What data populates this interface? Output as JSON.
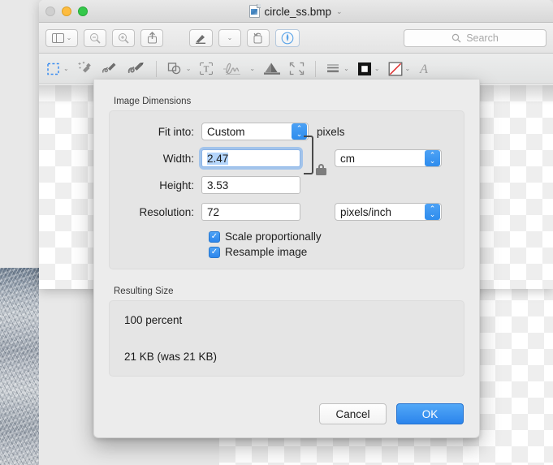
{
  "window": {
    "title": "circle_ss.bmp",
    "title_chevron": "⌄",
    "traffic_lights": [
      "close",
      "minimize",
      "zoom"
    ]
  },
  "toolbar": {
    "sidebar_label": "sidebar-view",
    "zoom_out_label": "zoom-out",
    "zoom_in_label": "zoom-in",
    "share_label": "share",
    "markup_label": "markup",
    "rotate_label": "rotate",
    "annotate_label": "annotate",
    "search_placeholder": "Search"
  },
  "markupbar": {
    "items": [
      "selection-tool",
      "instant-alpha-tool",
      "sketch-tool",
      "draw-tool",
      "shapes-tool",
      "text-tool",
      "signature-tool",
      "adjust-color-tool",
      "adjust-size-tool",
      "shape-style-tool",
      "border-color-tool",
      "fill-color-tool",
      "text-style-tool"
    ]
  },
  "dialog": {
    "dimensions": {
      "group_label": "Image Dimensions",
      "fit_into": {
        "label": "Fit into:",
        "value": "Custom",
        "unit_suffix": "pixels"
      },
      "width": {
        "label": "Width:",
        "value": "2.47"
      },
      "height": {
        "label": "Height:",
        "value": "3.53"
      },
      "resolution": {
        "label": "Resolution:",
        "value": "72"
      },
      "size_unit": {
        "value": "cm"
      },
      "resolution_unit": {
        "value": "pixels/inch"
      },
      "scale_proportionally": {
        "label": "Scale proportionally",
        "checked": true,
        "mark": "✓"
      },
      "resample_image": {
        "label": "Resample image",
        "checked": true,
        "mark": "✓"
      },
      "lock_icon": "lock-closed"
    },
    "resulting_size": {
      "group_label": "Resulting Size",
      "percent_line": "100 percent",
      "size_line": "21 KB (was 21 KB)"
    },
    "buttons": {
      "cancel": "Cancel",
      "ok": "OK"
    }
  },
  "colors": {
    "accent_blue": "#2b85ec",
    "focus_ring": "#8ab4e8",
    "selection_highlight": "#b4d5fb",
    "window_chrome": "#e9e9e9",
    "dialog_bg": "#ececec",
    "traffic_yellow": "#fdbc40",
    "traffic_green": "#34c84a",
    "traffic_gray": "#cfcfcf"
  }
}
